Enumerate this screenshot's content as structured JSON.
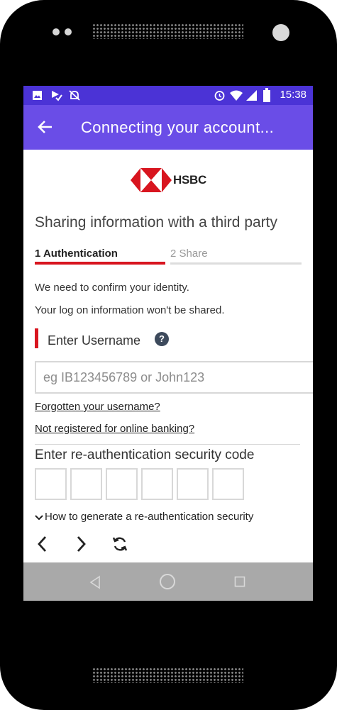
{
  "status_bar": {
    "time": "15:38",
    "left_icons": [
      "image-icon",
      "download-done-icon",
      "notifications-off-icon"
    ],
    "right_icons": [
      "alarm-icon",
      "wifi-icon",
      "signal-icon",
      "battery-icon"
    ]
  },
  "app_bar": {
    "title": "Connecting your account...",
    "back_icon": "arrow-back-icon"
  },
  "logo": {
    "text": "HSBC"
  },
  "page": {
    "heading": "Sharing information with a third party",
    "steps": [
      {
        "label": "1 Authentication",
        "active": true
      },
      {
        "label": "2 Share",
        "active": false
      }
    ],
    "info_lines": [
      "We need to confirm your identity.",
      "Your log on information won't be shared."
    ],
    "username_label": "Enter Username",
    "help_icon_glyph": "?",
    "username_placeholder": "eg IB123456789 or John123",
    "username_value": "",
    "links": {
      "forgot_username": "Forgotten your username?",
      "not_registered": "Not registered for online banking?"
    },
    "code_label": "Enter re-authentication security code",
    "code_digits": [
      "",
      "",
      "",
      "",
      "",
      ""
    ],
    "howto_text": "How to generate a re-authentication security"
  },
  "browser_controls": [
    "chevron-left-icon",
    "chevron-right-icon",
    "refresh-icon"
  ],
  "nav_bar": [
    "back-triangle-icon",
    "home-circle-icon",
    "recents-square-icon"
  ],
  "colors": {
    "status_bar": "#4b33d6",
    "app_bar": "#6a4de7",
    "brand_red": "#d8151f",
    "nav_bar": "#a9a9a9"
  }
}
